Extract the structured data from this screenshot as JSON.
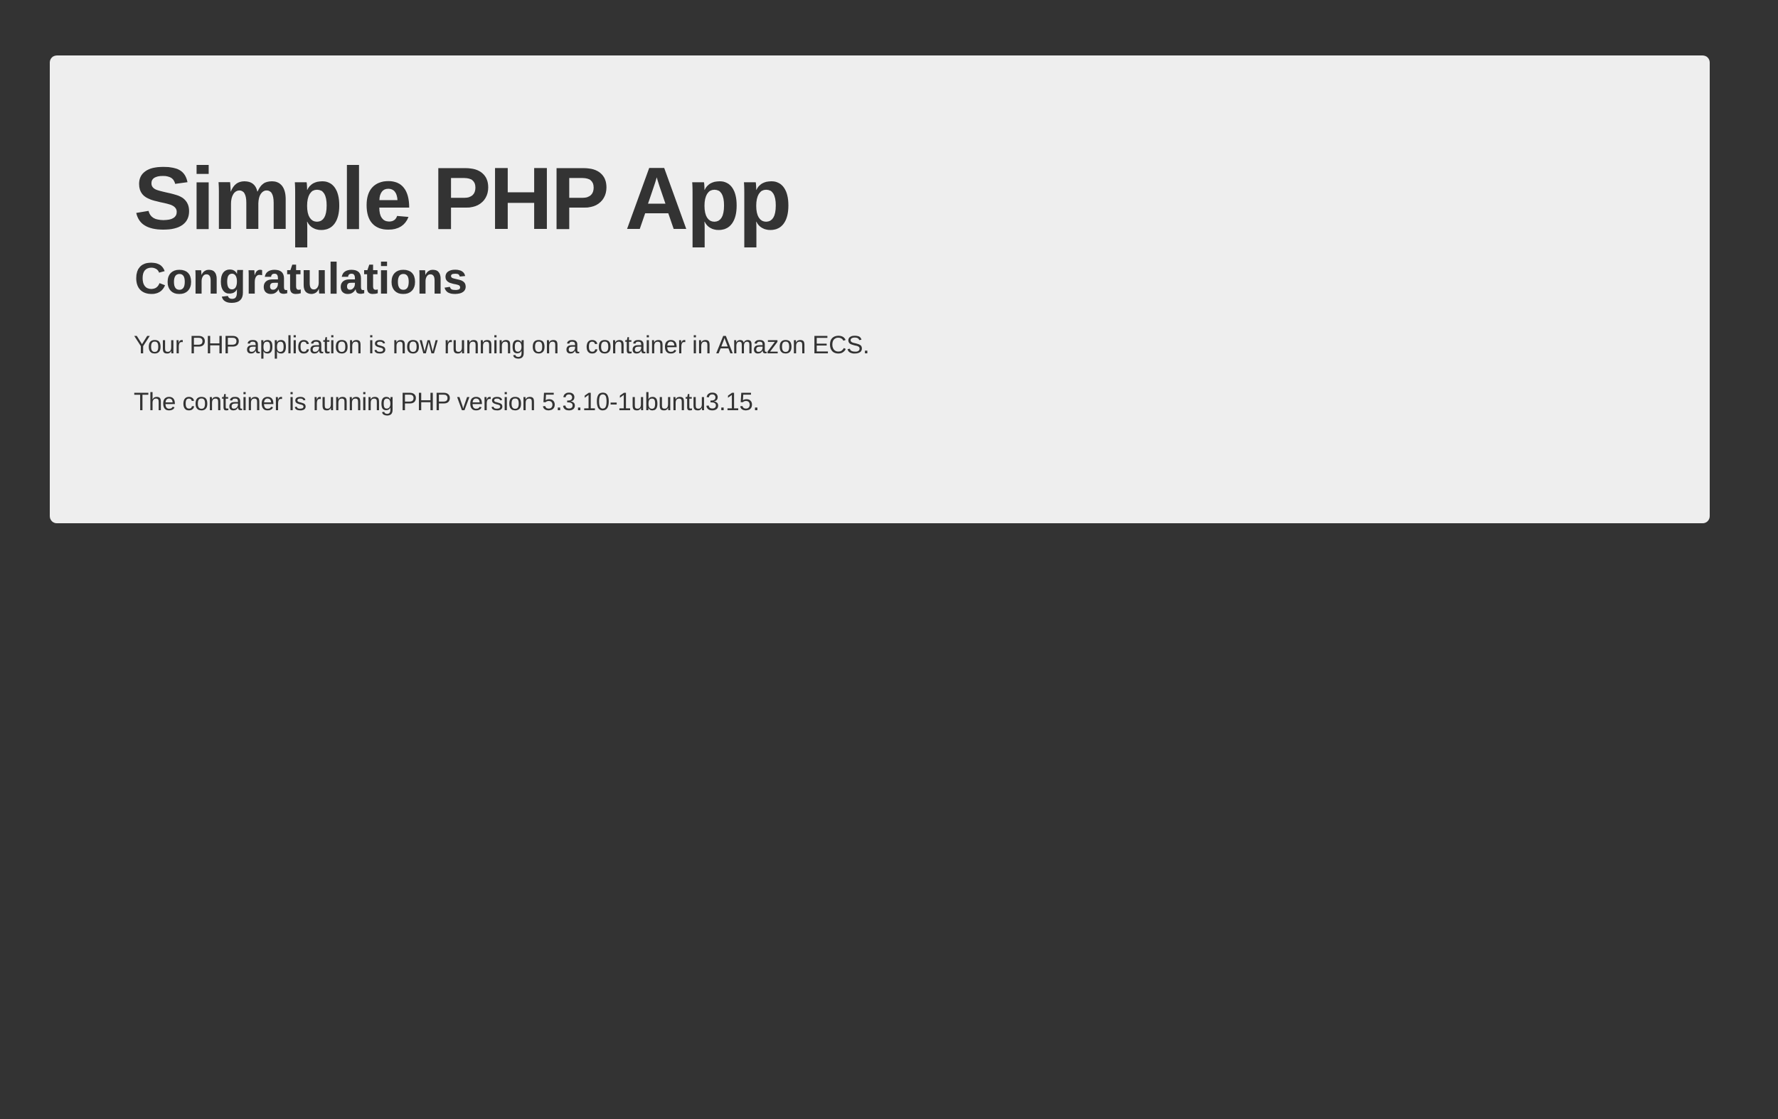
{
  "page": {
    "background_color": "#333333",
    "card_color": "#eeeeee",
    "text_color": "#333333"
  },
  "jumbotron": {
    "title": "Simple PHP App",
    "subtitle": "Congratulations",
    "message": "Your PHP application is now running on a container in Amazon ECS.",
    "version_line": "The container is running PHP version 5.3.10-1ubuntu3.15."
  }
}
